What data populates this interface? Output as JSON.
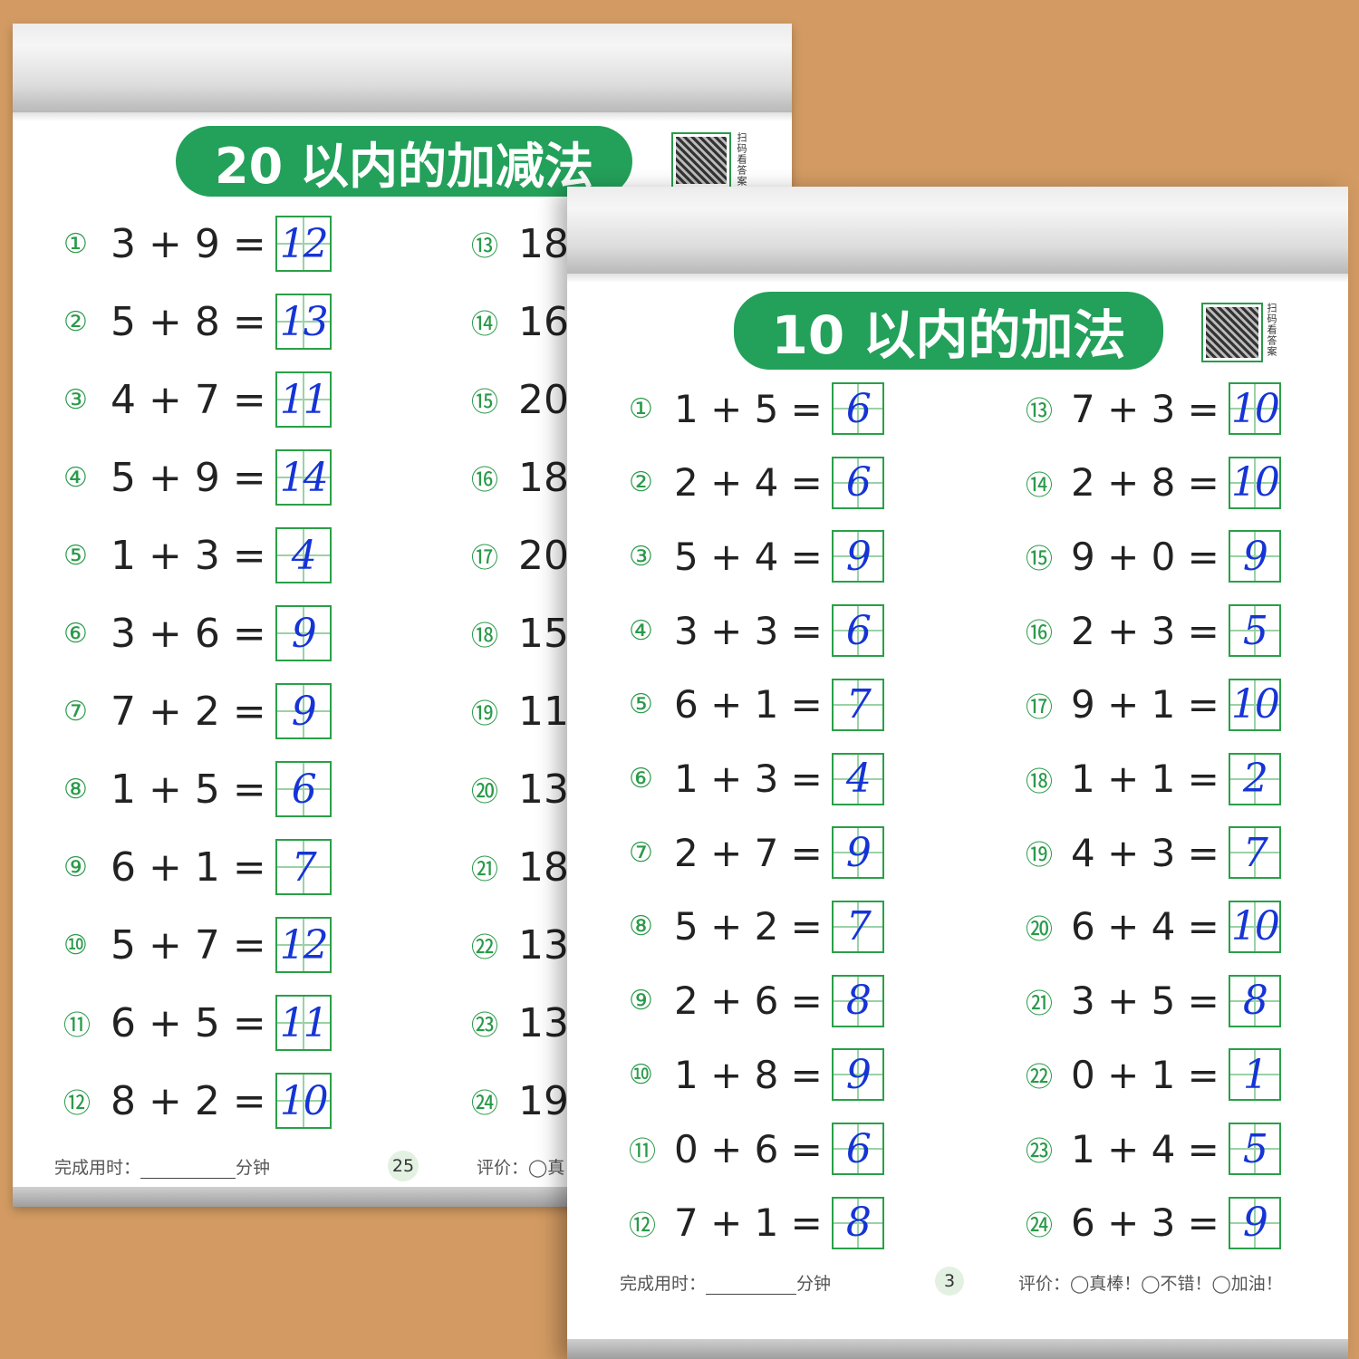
{
  "back_sheet": {
    "title": "20 以内的加减法",
    "qr_text": "扫码看答案",
    "problems_left": [
      {
        "num": "①",
        "expr": "3 + 9 =",
        "ans": "12"
      },
      {
        "num": "②",
        "expr": "5 + 8 =",
        "ans": "13"
      },
      {
        "num": "③",
        "expr": "4 + 7 =",
        "ans": "11"
      },
      {
        "num": "④",
        "expr": "5 + 9 =",
        "ans": "14"
      },
      {
        "num": "⑤",
        "expr": "1 + 3 =",
        "ans": "4"
      },
      {
        "num": "⑥",
        "expr": "3 + 6 =",
        "ans": "9"
      },
      {
        "num": "⑦",
        "expr": "7 + 2 =",
        "ans": "9"
      },
      {
        "num": "⑧",
        "expr": "1 + 5 =",
        "ans": "6"
      },
      {
        "num": "⑨",
        "expr": "6 + 1 =",
        "ans": "7"
      },
      {
        "num": "⑩",
        "expr": "5 + 7 =",
        "ans": "12"
      },
      {
        "num": "⑪",
        "expr": "6 + 5 =",
        "ans": "11"
      },
      {
        "num": "⑫",
        "expr": "8 + 2 =",
        "ans": "10"
      }
    ],
    "problems_right": [
      {
        "num": "⑬",
        "expr": "18"
      },
      {
        "num": "⑭",
        "expr": "16"
      },
      {
        "num": "⑮",
        "expr": "20"
      },
      {
        "num": "⑯",
        "expr": "18"
      },
      {
        "num": "⑰",
        "expr": "20"
      },
      {
        "num": "⑱",
        "expr": "15"
      },
      {
        "num": "⑲",
        "expr": "11"
      },
      {
        "num": "⑳",
        "expr": "13"
      },
      {
        "num": "㉑",
        "expr": "18"
      },
      {
        "num": "㉒",
        "expr": "13"
      },
      {
        "num": "㉓",
        "expr": "13"
      },
      {
        "num": "㉔",
        "expr": "19"
      }
    ],
    "footer_time_label": "完成用时：",
    "footer_time_unit": "分钟",
    "page_number": "25",
    "footer_eval": "评价：◯真"
  },
  "front_sheet": {
    "title": "10 以内的加法",
    "qr_text": "扫码看答案",
    "problems_left": [
      {
        "num": "①",
        "expr": "1 + 5 =",
        "ans": "6"
      },
      {
        "num": "②",
        "expr": "2 + 4 =",
        "ans": "6"
      },
      {
        "num": "③",
        "expr": "5 + 4 =",
        "ans": "9"
      },
      {
        "num": "④",
        "expr": "3 + 3 =",
        "ans": "6"
      },
      {
        "num": "⑤",
        "expr": "6 + 1 =",
        "ans": "7"
      },
      {
        "num": "⑥",
        "expr": "1 + 3 =",
        "ans": "4"
      },
      {
        "num": "⑦",
        "expr": "2 + 7 =",
        "ans": "9"
      },
      {
        "num": "⑧",
        "expr": "5 + 2 =",
        "ans": "7"
      },
      {
        "num": "⑨",
        "expr": "2 + 6 =",
        "ans": "8"
      },
      {
        "num": "⑩",
        "expr": "1 + 8 =",
        "ans": "9"
      },
      {
        "num": "⑪",
        "expr": "0 + 6 =",
        "ans": "6"
      },
      {
        "num": "⑫",
        "expr": "7 + 1 =",
        "ans": "8"
      }
    ],
    "problems_right": [
      {
        "num": "⑬",
        "expr": "7 + 3 =",
        "ans": "10"
      },
      {
        "num": "⑭",
        "expr": "2 + 8 =",
        "ans": "10"
      },
      {
        "num": "⑮",
        "expr": "9 + 0 =",
        "ans": "9"
      },
      {
        "num": "⑯",
        "expr": "2 + 3 =",
        "ans": "5"
      },
      {
        "num": "⑰",
        "expr": "9 + 1 =",
        "ans": "10"
      },
      {
        "num": "⑱",
        "expr": "1 + 1 =",
        "ans": "2"
      },
      {
        "num": "⑲",
        "expr": "4 + 3 =",
        "ans": "7"
      },
      {
        "num": "⑳",
        "expr": "6 + 4 =",
        "ans": "10"
      },
      {
        "num": "㉑",
        "expr": "3 + 5 =",
        "ans": "8"
      },
      {
        "num": "㉒",
        "expr": "0 + 1 =",
        "ans": "1"
      },
      {
        "num": "㉓",
        "expr": "1 + 4 =",
        "ans": "5"
      },
      {
        "num": "㉔",
        "expr": "6 + 3 =",
        "ans": "9"
      }
    ],
    "footer_time_label": "完成用时：",
    "footer_time_unit": "分钟",
    "page_number": "3",
    "footer_eval": "评价：◯真棒！◯不错！◯加油！"
  },
  "colors": {
    "background": "#d39b63",
    "title_green": "#23a05a",
    "box_green": "#2aa048",
    "answer_blue": "#1634d6"
  }
}
